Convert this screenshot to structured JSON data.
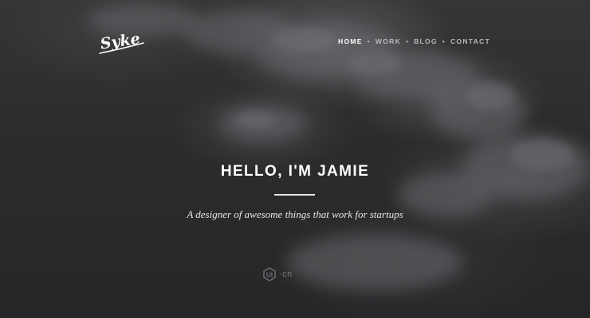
{
  "brand": {
    "logo_text": "Syke"
  },
  "nav": {
    "items": [
      {
        "label": "HOME",
        "active": true
      },
      {
        "label": "WORK",
        "active": false
      },
      {
        "label": "BLOG",
        "active": false
      },
      {
        "label": "CONTACT",
        "active": false
      }
    ],
    "separator": "•"
  },
  "hero": {
    "headline": "HELLO, I'M JAMIE",
    "tagline": "A designer of awesome things that work for startups"
  },
  "watermark": {
    "badge_text": "UI",
    "suffix": "·cn"
  },
  "colors": {
    "background": "#2e2e30",
    "text": "#ffffff",
    "nav_inactive": "#b9b9bc"
  }
}
